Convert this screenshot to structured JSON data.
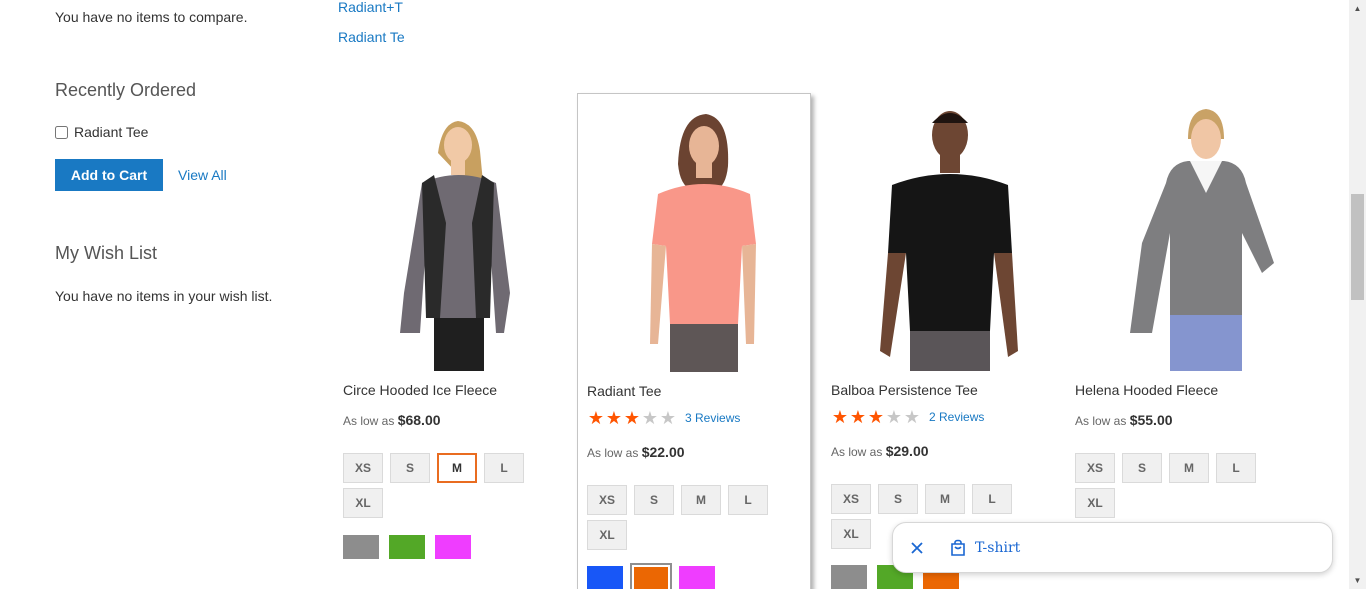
{
  "sidebar": {
    "compare_empty": "You have no items to compare.",
    "recently_ordered": {
      "title": "Recently Ordered",
      "item": "Radiant Tee",
      "add_to_cart": "Add to Cart",
      "view_all": "View All"
    },
    "wishlist": {
      "title": "My Wish List",
      "empty": "You have no items in your wish list."
    }
  },
  "search_links": [
    "Radiant+T",
    "Radiant Te"
  ],
  "products": [
    {
      "name": "Circe Hooded Ice Fleece",
      "price_prefix": "As low as",
      "price": "$68.00",
      "sizes": [
        "XS",
        "S",
        "M",
        "L",
        "XL"
      ],
      "selected_size": "M",
      "colors": [
        "#8d8d8d",
        "#53a827",
        "#ef3dff"
      ]
    },
    {
      "name": "Radiant Tee",
      "rating": 3,
      "reviews": "3 Reviews",
      "price_prefix": "As low as",
      "price": "$22.00",
      "sizes": [
        "XS",
        "S",
        "M",
        "L",
        "XL"
      ],
      "colors": [
        "#1857f7",
        "#eb6703",
        "#ef3dff"
      ],
      "selected_color": "#eb6703"
    },
    {
      "name": "Balboa Persistence Tee",
      "rating": 3,
      "reviews": "2 Reviews",
      "price_prefix": "As low as",
      "price": "$29.00",
      "sizes": [
        "XS",
        "S",
        "M",
        "L",
        "XL"
      ],
      "colors": [
        "#8d8d8d",
        "#53a827",
        "#eb6703"
      ]
    },
    {
      "name": "Helena Hooded Fleece",
      "price_prefix": "As low as",
      "price": "$55.00",
      "sizes": [
        "XS",
        "S",
        "M",
        "L",
        "XL"
      ]
    }
  ],
  "toast": {
    "label": "T-shirt",
    "close_icon": "close-icon",
    "bag_icon": "shopping-bag-icon"
  }
}
